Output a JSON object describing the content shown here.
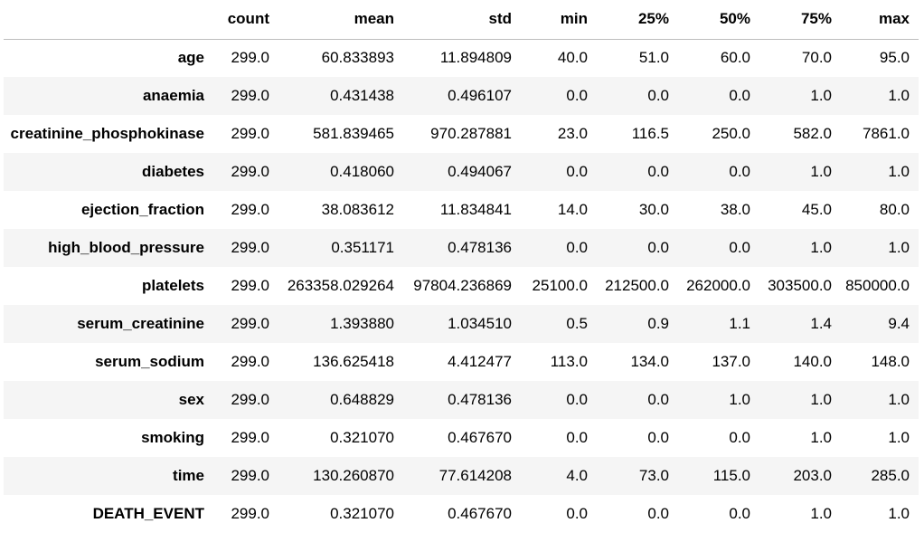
{
  "table": {
    "index_header": "",
    "columns": [
      "count",
      "mean",
      "std",
      "min",
      "25%",
      "50%",
      "75%",
      "max"
    ],
    "rows": [
      {
        "label": "age",
        "values": [
          "299.0",
          "60.833893",
          "11.894809",
          "40.0",
          "51.0",
          "60.0",
          "70.0",
          "95.0"
        ]
      },
      {
        "label": "anaemia",
        "values": [
          "299.0",
          "0.431438",
          "0.496107",
          "0.0",
          "0.0",
          "0.0",
          "1.0",
          "1.0"
        ]
      },
      {
        "label": "creatinine_phosphokinase",
        "values": [
          "299.0",
          "581.839465",
          "970.287881",
          "23.0",
          "116.5",
          "250.0",
          "582.0",
          "7861.0"
        ]
      },
      {
        "label": "diabetes",
        "values": [
          "299.0",
          "0.418060",
          "0.494067",
          "0.0",
          "0.0",
          "0.0",
          "1.0",
          "1.0"
        ]
      },
      {
        "label": "ejection_fraction",
        "values": [
          "299.0",
          "38.083612",
          "11.834841",
          "14.0",
          "30.0",
          "38.0",
          "45.0",
          "80.0"
        ]
      },
      {
        "label": "high_blood_pressure",
        "values": [
          "299.0",
          "0.351171",
          "0.478136",
          "0.0",
          "0.0",
          "0.0",
          "1.0",
          "1.0"
        ]
      },
      {
        "label": "platelets",
        "values": [
          "299.0",
          "263358.029264",
          "97804.236869",
          "25100.0",
          "212500.0",
          "262000.0",
          "303500.0",
          "850000.0"
        ]
      },
      {
        "label": "serum_creatinine",
        "values": [
          "299.0",
          "1.393880",
          "1.034510",
          "0.5",
          "0.9",
          "1.1",
          "1.4",
          "9.4"
        ]
      },
      {
        "label": "serum_sodium",
        "values": [
          "299.0",
          "136.625418",
          "4.412477",
          "113.0",
          "134.0",
          "137.0",
          "140.0",
          "148.0"
        ]
      },
      {
        "label": "sex",
        "values": [
          "299.0",
          "0.648829",
          "0.478136",
          "0.0",
          "0.0",
          "1.0",
          "1.0",
          "1.0"
        ]
      },
      {
        "label": "smoking",
        "values": [
          "299.0",
          "0.321070",
          "0.467670",
          "0.0",
          "0.0",
          "0.0",
          "1.0",
          "1.0"
        ]
      },
      {
        "label": "time",
        "values": [
          "299.0",
          "130.260870",
          "77.614208",
          "4.0",
          "73.0",
          "115.0",
          "203.0",
          "285.0"
        ]
      },
      {
        "label": "DEATH_EVENT",
        "values": [
          "299.0",
          "0.321070",
          "0.467670",
          "0.0",
          "0.0",
          "0.0",
          "1.0",
          "1.0"
        ]
      }
    ]
  },
  "colors": {
    "stripe": "#f5f5f5",
    "header_rule": "#bdbdbd",
    "text": "#000000"
  }
}
